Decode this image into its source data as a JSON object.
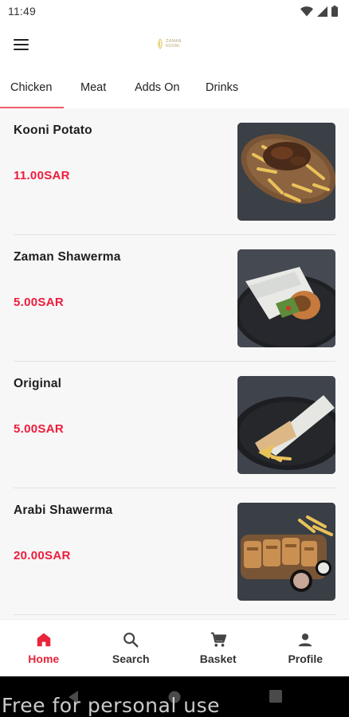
{
  "status": {
    "time": "11:49",
    "icons": [
      "wifi-icon",
      "signal-icon",
      "battery-icon"
    ]
  },
  "app_bar": {
    "menu_icon": "hamburger-menu-icon",
    "logo_lines": [
      "ZAMAN",
      "KOONI"
    ]
  },
  "tabs": [
    {
      "label": "Chicken",
      "active": true
    },
    {
      "label": "Meat",
      "active": false
    },
    {
      "label": "Adds On",
      "active": false
    },
    {
      "label": "Drinks",
      "active": false
    }
  ],
  "items": [
    {
      "name": "Kooni Potato",
      "price": "11.00SAR",
      "image": "fries-with-shawarma-platter"
    },
    {
      "name": "Zaman Shawerma",
      "price": "5.00SAR",
      "image": "wrapped-shawarma-sandwich"
    },
    {
      "name": "Original",
      "price": "5.00SAR",
      "image": "shawarma-wrap-with-fries"
    },
    {
      "name": "Arabi Shawerma",
      "price": "20.00SAR",
      "image": "arabi-shawarma-platter-with-dips"
    }
  ],
  "bottom_nav": [
    {
      "label": "Home",
      "icon": "home-icon",
      "active": true
    },
    {
      "label": "Search",
      "icon": "search-icon",
      "active": false
    },
    {
      "label": "Basket",
      "icon": "cart-icon",
      "active": false
    },
    {
      "label": "Profile",
      "icon": "person-icon",
      "active": false
    }
  ],
  "watermark": "Free for personal use",
  "colors": {
    "accent": "#e8253a",
    "price": "#ee1c3c",
    "tab_indicator": "#f05b6b",
    "list_bg": "#f7f7f7"
  }
}
